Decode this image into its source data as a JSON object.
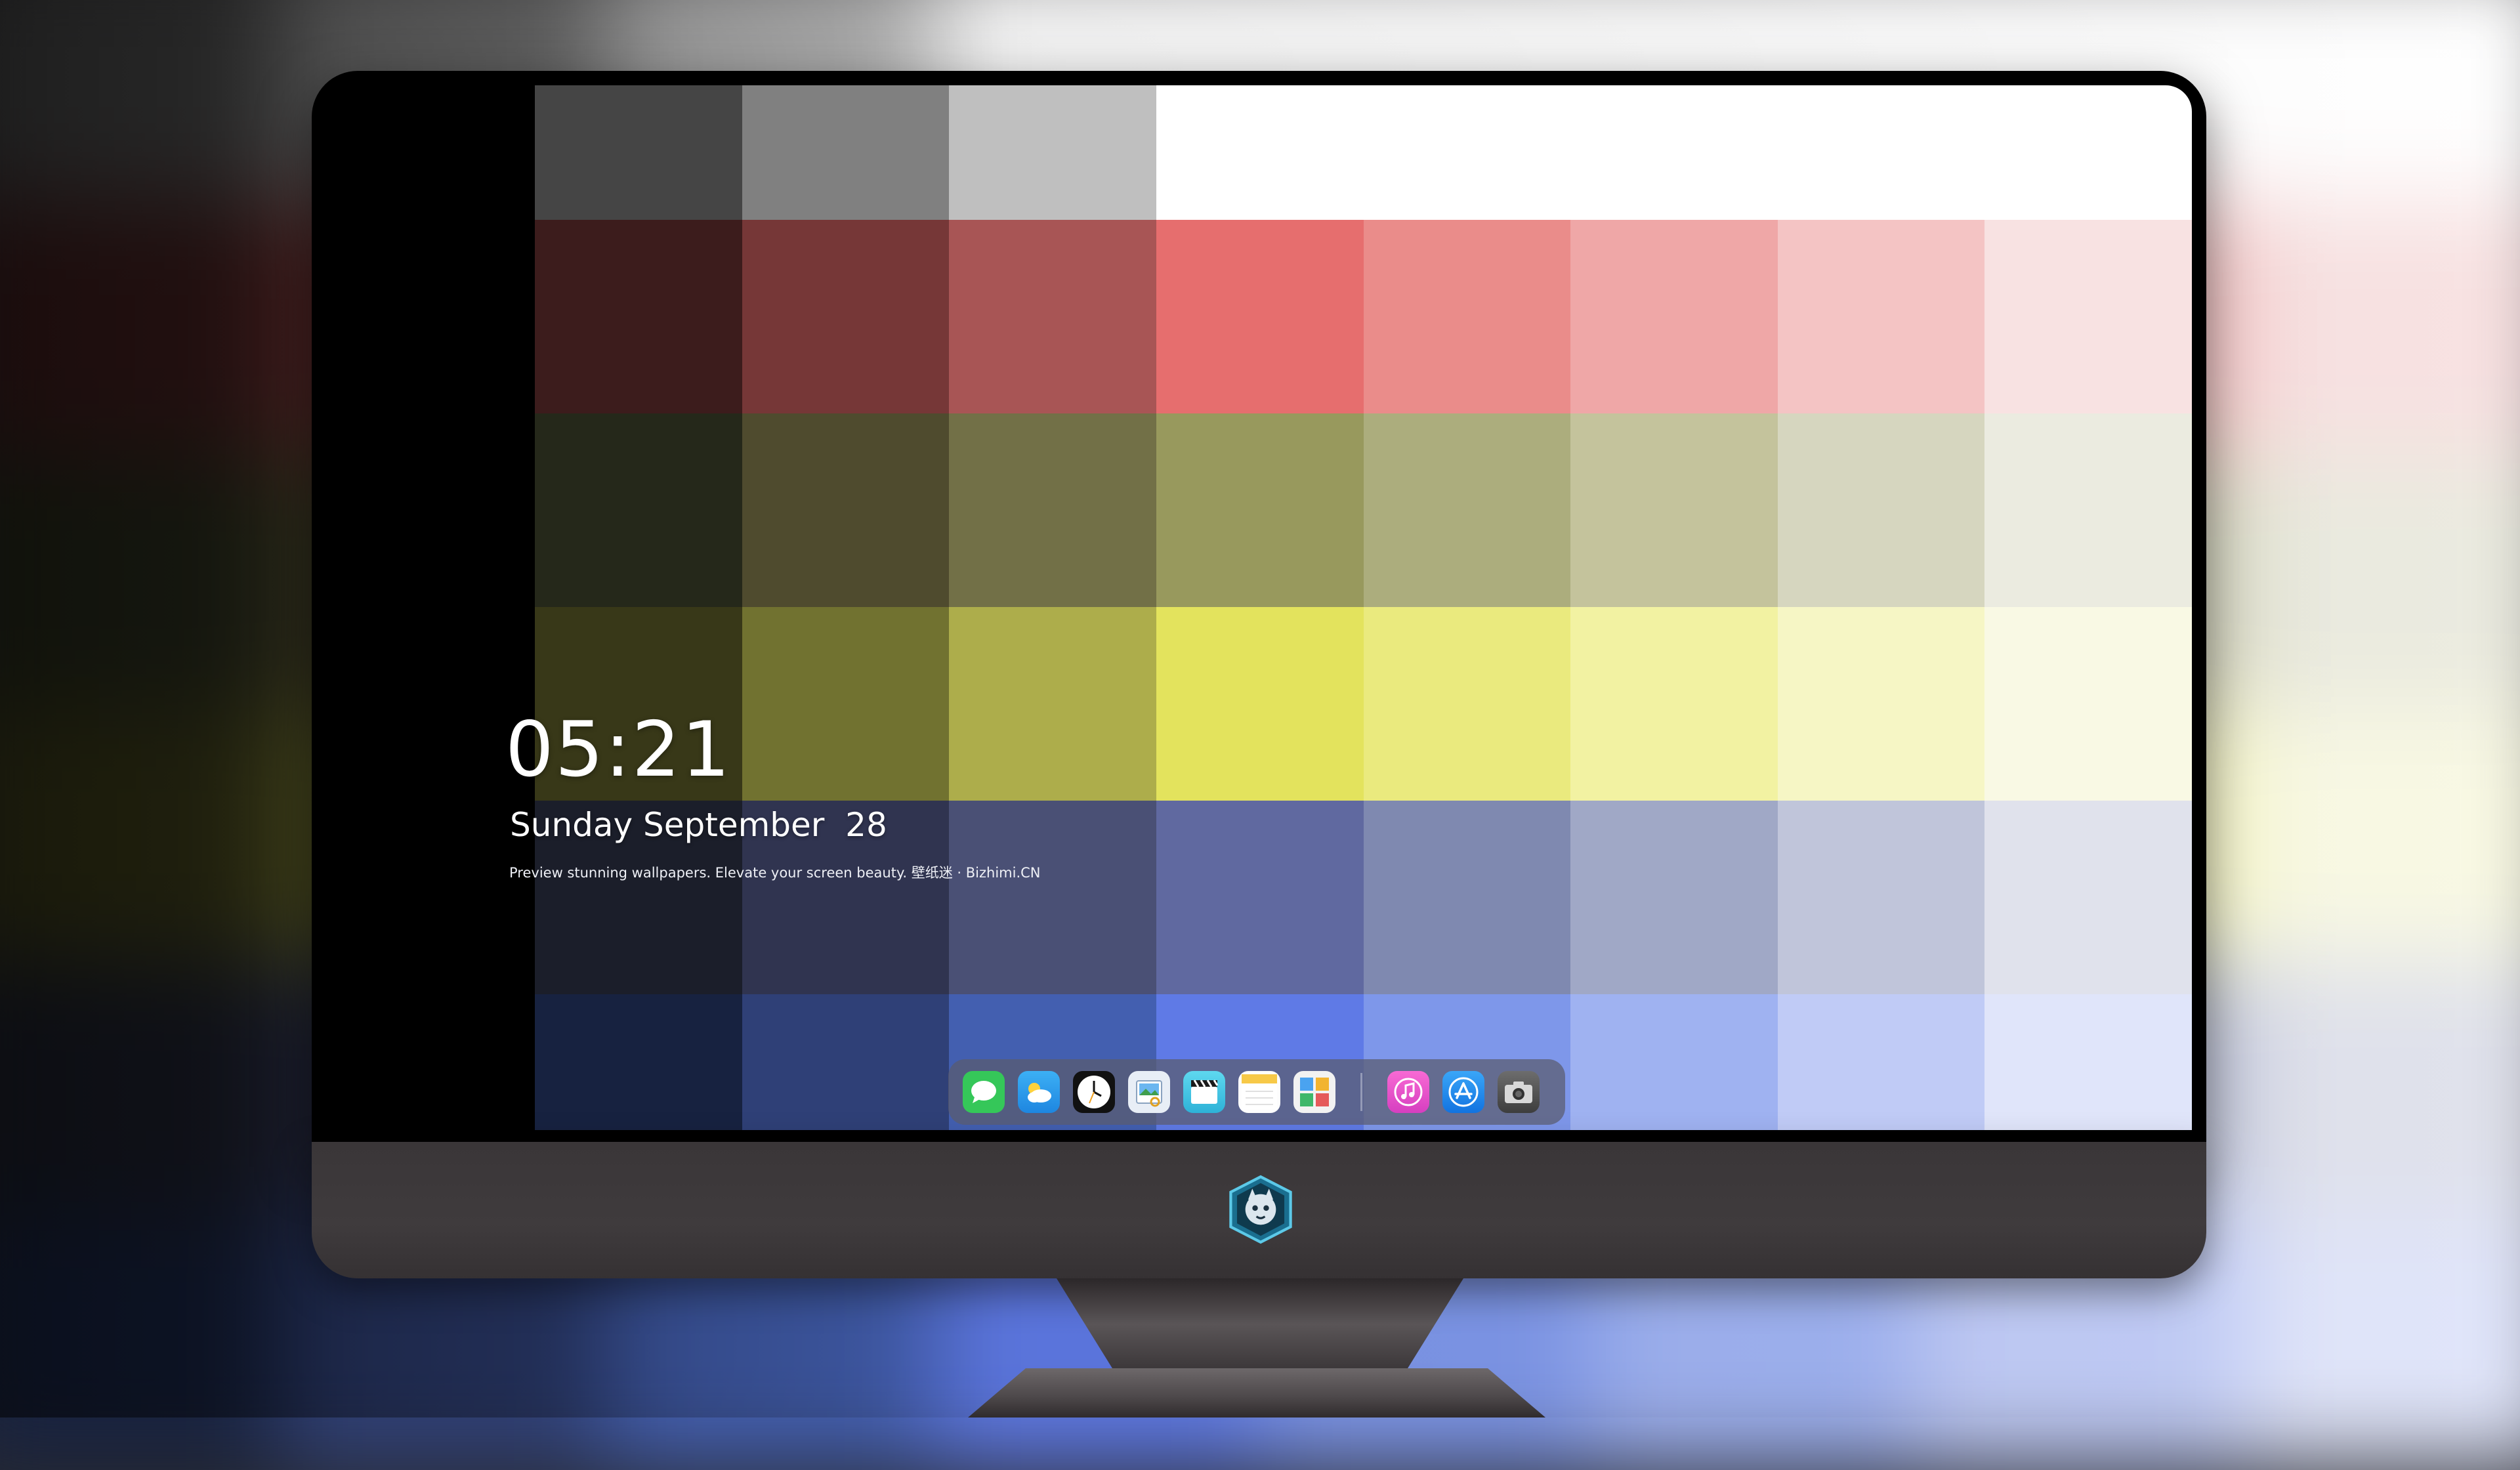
{
  "lockscreen": {
    "time": "05:21",
    "date": "Sunday September  28",
    "tagline": "Preview stunning wallpapers. Elevate your screen beauty. 壁纸迷 · Bizhimi.CN"
  },
  "wallpaper": {
    "rows": [
      [
        "#454545",
        "#808080",
        "#bfbfbf",
        "#ffffff",
        "#ffffff",
        "#ffffff",
        "#ffffff",
        "#ffffff"
      ],
      [
        "#3c1c1c",
        "#763737",
        "#a85555",
        "#e66e6e",
        "#ea8c8a",
        "#efa7a7",
        "#f4c4c4",
        "#f8e2e2"
      ],
      [
        "#25281a",
        "#4f4b2e",
        "#727047",
        "#98995d",
        "#acad7d",
        "#c4c39c",
        "#d6d6bf",
        "#ebebe0"
      ],
      [
        "#383818",
        "#717230",
        "#adad4b",
        "#e3e35d",
        "#eaea7e",
        "#f2f2a2",
        "#f6f6c5",
        "#f9f9e4"
      ],
      [
        "#1b1e2a",
        "#303450",
        "#4a5075",
        "#6069a0",
        "#7f89b0",
        "#a0a8c6",
        "#c0c5da",
        "#e0e2ec"
      ],
      [
        "#172240",
        "#2f4077",
        "#435fb0",
        "#5f7ae6",
        "#7e97ea",
        "#9fb2f1",
        "#c0cbf6",
        "#e0e5fa"
      ]
    ]
  },
  "dock": {
    "apps": [
      {
        "icon": "messages-icon",
        "bg": "#35c759"
      },
      {
        "icon": "weather-icon",
        "bg": "#2aa0f0"
      },
      {
        "icon": "clock-icon",
        "bg": "#111111"
      },
      {
        "icon": "preview-icon",
        "bg": "#e8eef6"
      },
      {
        "icon": "clips-icon",
        "bg": "#56c8e6"
      },
      {
        "icon": "notes-icon",
        "bg": "#fdfdfd"
      },
      {
        "icon": "photo-grid-icon",
        "bg": "#f2f2f2"
      }
    ],
    "apps_right": [
      {
        "icon": "music-icon",
        "bg": "#f058c8"
      },
      {
        "icon": "app-store-icon",
        "bg": "#1e8af0"
      },
      {
        "icon": "camera-icon",
        "bg": "#5a5a5a"
      }
    ]
  }
}
